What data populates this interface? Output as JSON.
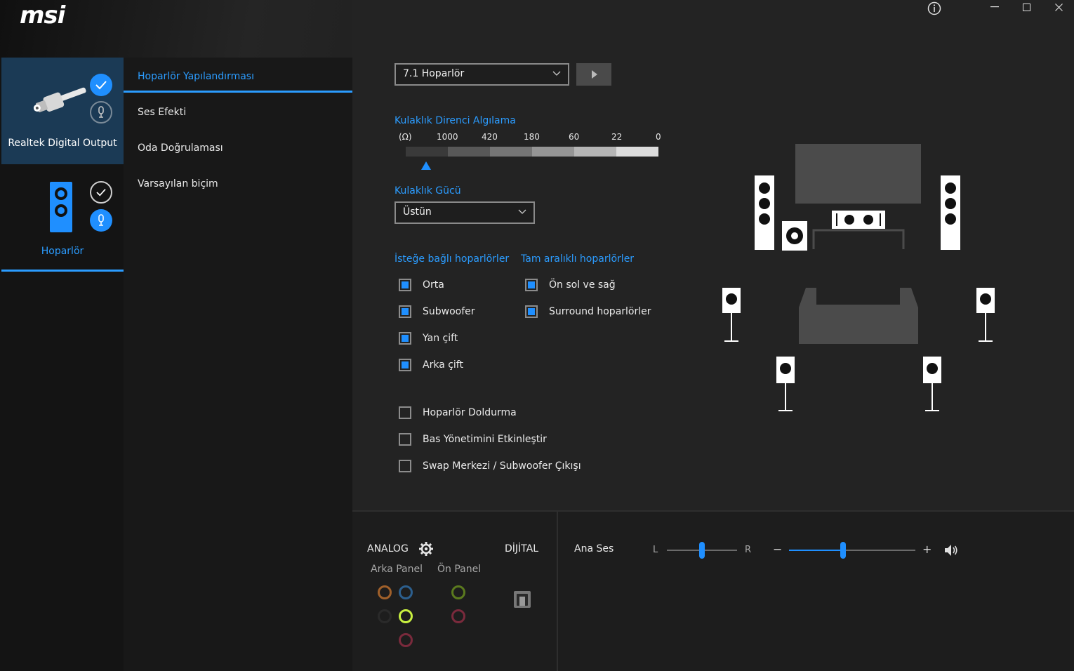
{
  "brand": {
    "logo_text": "msi"
  },
  "devices": [
    {
      "label": "Realtek Digital Output",
      "selected": true
    },
    {
      "label": "Hoparlör",
      "selected": false
    }
  ],
  "menu": {
    "items": [
      "Hoparlör Yapılandırması",
      "Ses Efekti",
      "Oda Doğrulaması",
      "Varsayılan biçim"
    ],
    "active_index": 0
  },
  "speaker_config": {
    "selected": "7.1 Hoparlör"
  },
  "headphone_impedance": {
    "title": "Kulaklık Direnci Algılama",
    "unit": "(Ω)",
    "ticks": [
      "1000",
      "420",
      "180",
      "60",
      "22",
      "0"
    ]
  },
  "headphone_power": {
    "title": "Kulaklık Gücü",
    "selected": "Üstün"
  },
  "optional_speakers": {
    "title": "İsteğe bağlı hoparlörler",
    "items": [
      {
        "label": "Orta",
        "checked": true
      },
      {
        "label": "Subwoofer",
        "checked": true
      },
      {
        "label": "Yan çift",
        "checked": true
      },
      {
        "label": "Arka çift",
        "checked": true
      }
    ]
  },
  "fullrange_speakers": {
    "title": "Tam aralıklı hoparlörler",
    "items": [
      {
        "label": "Ön sol ve sağ",
        "checked": true
      },
      {
        "label": "Surround hoparlörler",
        "checked": true
      }
    ]
  },
  "extra_options": [
    {
      "label": "Hoparlör Doldurma",
      "checked": false
    },
    {
      "label": "Bas Yönetimini Etkinleştir",
      "checked": false
    },
    {
      "label": "Swap Merkezi / Subwoofer Çıkışı",
      "checked": false
    }
  ],
  "connectors": {
    "analog_label": "ANALOG",
    "digital_label": "DİJİTAL",
    "back_panel_label": "Arka Panel",
    "front_panel_label": "Ön Panel",
    "colors": {
      "orange": "#a0602a",
      "blue": "#2c5f8e",
      "black": "#2a2a2a",
      "lime": "#c8f040",
      "pink": "#7a2a3c",
      "green": "#5b7a1e"
    }
  },
  "master_volume": {
    "label": "Ana Ses",
    "balance_left": "L",
    "balance_right": "R",
    "balance": 0.5,
    "volume": 0.43,
    "minus": "−",
    "plus": "+"
  },
  "accent_color": "#2b9cff"
}
